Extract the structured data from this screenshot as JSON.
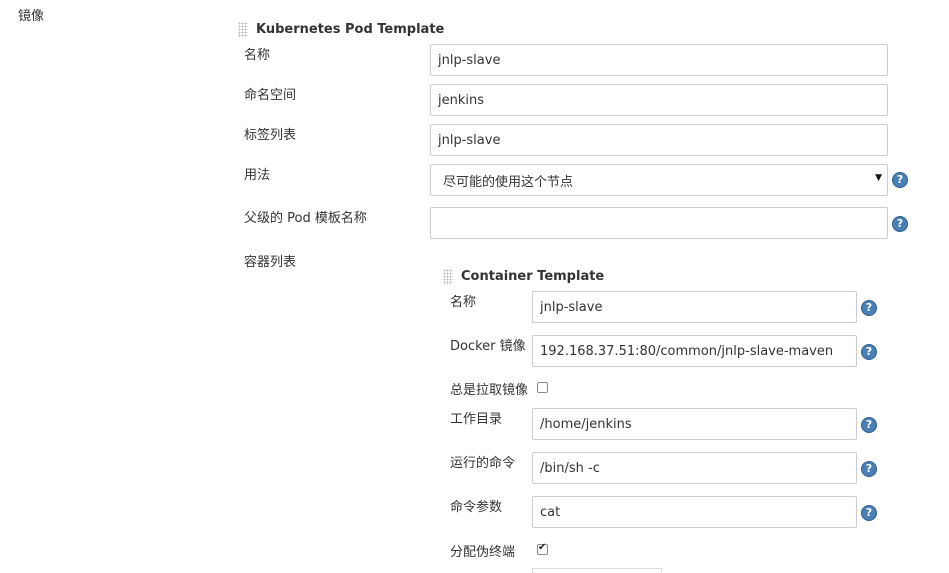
{
  "section_label": "镜像",
  "pod_template": {
    "title": "Kubernetes Pod Template",
    "name_label": "名称",
    "name_value": "jnlp-slave",
    "namespace_label": "命名空间",
    "namespace_value": "jenkins",
    "labels_label": "标签列表",
    "labels_value": "jnlp-slave",
    "usage_label": "用法",
    "usage_value": "尽可能的使用这个节点",
    "parent_label": "父级的 Pod 模板名称",
    "parent_value": "",
    "containers_label": "容器列表"
  },
  "container_template": {
    "title": "Container Template",
    "name_label": "名称",
    "name_value": "jnlp-slave",
    "image_label": "Docker 镜像",
    "image_value": "192.168.37.51:80/common/jnlp-slave-maven",
    "always_pull_label": "总是拉取镜像",
    "always_pull_checked": false,
    "workdir_label": "工作目录",
    "workdir_value": "/home/jenkins",
    "command_label": "运行的命令",
    "command_value": "/bin/sh -c",
    "args_label": "命令参数",
    "args_value": "cat",
    "tty_label": "分配伪终端",
    "tty_checked": true
  },
  "help_icon_text": "?",
  "colors": {
    "help_icon": "#4a7fb5",
    "border": "#cccccc",
    "text": "#333333"
  }
}
